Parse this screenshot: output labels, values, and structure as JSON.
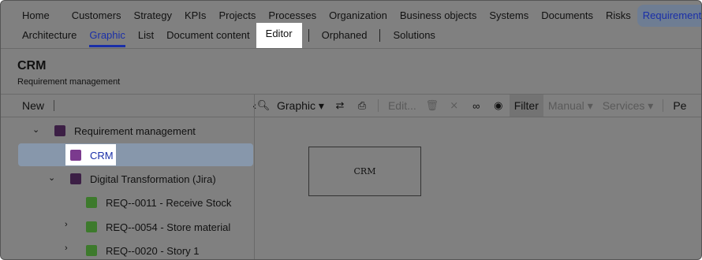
{
  "nav_primary": [
    "Home",
    "Customers",
    "Strategy",
    "KPIs",
    "Projects",
    "Processes",
    "Organization",
    "Business objects",
    "Systems",
    "Documents",
    "Risks",
    "Requirements"
  ],
  "nav_secondary": [
    "Architecture",
    "Graphic",
    "List",
    "Document content",
    "Editor",
    "Orphaned",
    "Solutions"
  ],
  "page": {
    "title": "CRM",
    "subtitle": "Requirement management"
  },
  "left_panel": {
    "new_label": "New",
    "collapse_icon": "chevron-left-icon"
  },
  "tree": [
    {
      "label": "Requirement management",
      "color": "#3c1f45",
      "expanded": true
    },
    {
      "label": "CRM",
      "color": "#7b3a8e",
      "selected": true
    },
    {
      "label": "Digital Transformation (Jira)",
      "color": "#3c1f45",
      "expanded": true
    },
    {
      "label": "REQ--0011 - Receive Stock",
      "color": "#3d7a2c"
    },
    {
      "label": "REQ--0054 - Store material",
      "color": "#3d7a2c",
      "expanded": false
    },
    {
      "label": "REQ--0020 - Story 1",
      "color": "#3d7a2c",
      "expanded": false
    }
  ],
  "toolbar": {
    "view_label": "Graphic",
    "edit_label": "Edit...",
    "filter_label": "Filter",
    "manual_label": "Manual",
    "services_label": "Services",
    "truncated_label": "Pe"
  },
  "canvas": {
    "node_label": "CRM"
  },
  "colors": {
    "accent": "#1a2fa8"
  }
}
